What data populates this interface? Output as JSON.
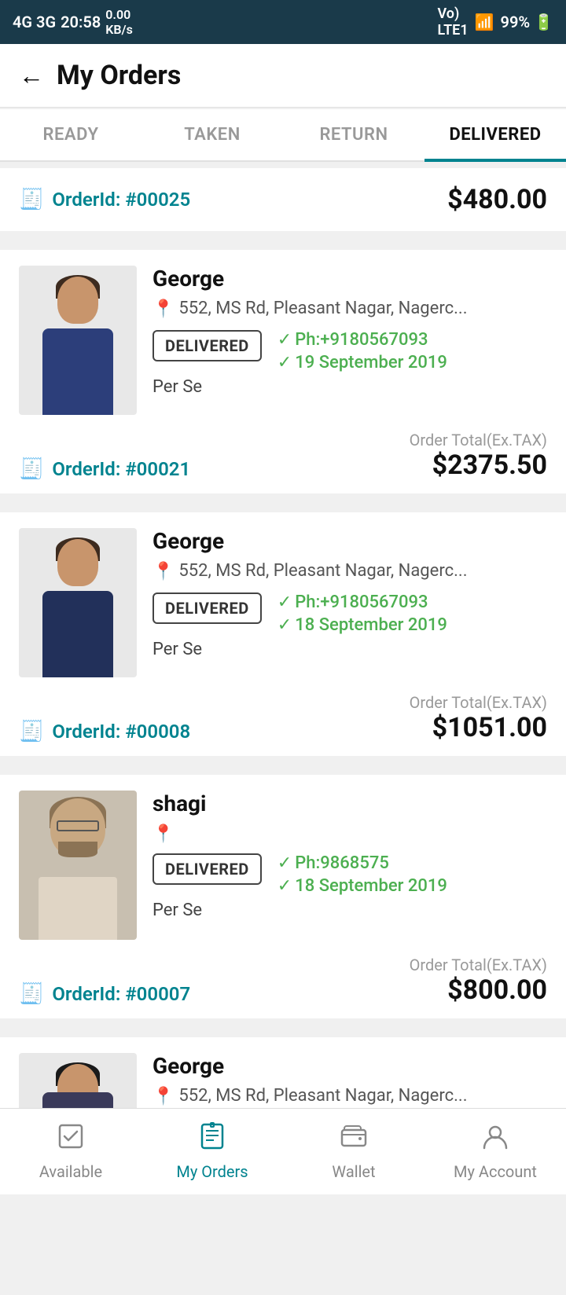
{
  "statusBar": {
    "left": "4G 3G 20:58 0.00 KB/s",
    "time": "20:58",
    "network": "4G 3G",
    "data_speed": "0.00 KB/s",
    "right": "Vo LTE1 99%"
  },
  "header": {
    "back_label": "←",
    "title": "My Orders"
  },
  "tabs": [
    {
      "label": "READY",
      "active": false
    },
    {
      "label": "TAKEN",
      "active": false
    },
    {
      "label": "RETURN",
      "active": false
    },
    {
      "label": "DELIVERED",
      "active": true
    }
  ],
  "summaryCard": {
    "orderId": "OrderId: #00025",
    "amount": "$480.00"
  },
  "orders": [
    {
      "customer": "George",
      "address": "552, MS Rd, Pleasant Nagar, Nagerc...",
      "status": "DELIVERED",
      "phone": "Ph:+9180567093",
      "date": "19 September 2019",
      "seller": "Per Se",
      "orderId": "OrderId: #00021",
      "totalLabel": "Order Total(Ex.TAX)",
      "total": "$2375.50",
      "imgType": "shirt_person"
    },
    {
      "customer": "George",
      "address": "552, MS Rd, Pleasant Nagar, Nagerc...",
      "status": "DELIVERED",
      "phone": "Ph:+9180567093",
      "date": "18 September 2019",
      "seller": "Per Se",
      "orderId": "OrderId: #00008",
      "totalLabel": "Order Total(Ex.TAX)",
      "total": "$1051.00",
      "imgType": "shirt_person"
    },
    {
      "customer": "shagi",
      "address": "",
      "status": "DELIVERED",
      "phone": "Ph:9868575",
      "date": "18 September 2019",
      "seller": "Per Se",
      "orderId": "OrderId: #00007",
      "totalLabel": "Order Total(Ex.TAX)",
      "total": "$800.00",
      "imgType": "face_person"
    },
    {
      "customer": "George",
      "address": "552, MS Rd, Pleasant Nagar, Nagerc...",
      "status": "",
      "phone": "",
      "date": "",
      "seller": "",
      "orderId": "",
      "totalLabel": "",
      "total": "",
      "imgType": "shirt_person_partial"
    }
  ],
  "bottomNav": [
    {
      "label": "Available",
      "icon": "☑",
      "active": false
    },
    {
      "label": "My Orders",
      "icon": "📋",
      "active": true
    },
    {
      "label": "Wallet",
      "icon": "👛",
      "active": false
    },
    {
      "label": "My Account",
      "icon": "👤",
      "active": false
    }
  ]
}
